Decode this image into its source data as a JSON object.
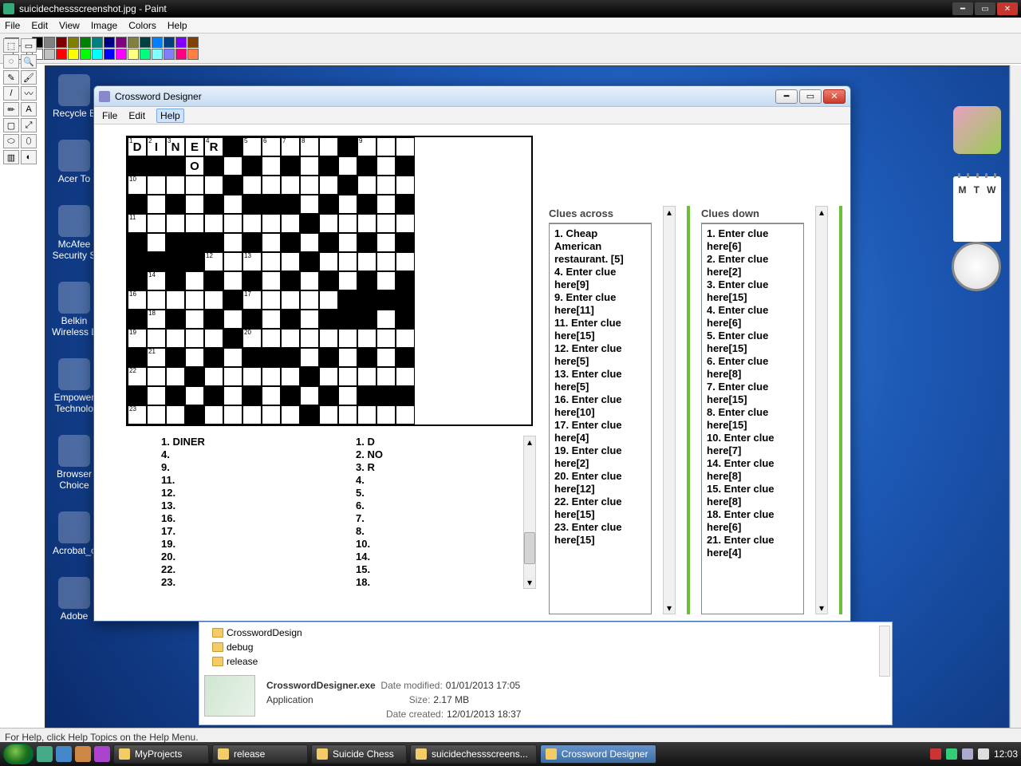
{
  "paint": {
    "title": "suicidechessscreenshot.jpg - Paint",
    "menu": [
      "File",
      "Edit",
      "View",
      "Image",
      "Colors",
      "Help"
    ],
    "palette": [
      "#000000",
      "#808080",
      "#800000",
      "#808000",
      "#008000",
      "#008080",
      "#000080",
      "#800080",
      "#808040",
      "#004040",
      "#0080ff",
      "#004080",
      "#8000ff",
      "#804000",
      "#ffffff",
      "#c0c0c0",
      "#ff0000",
      "#ffff00",
      "#00ff00",
      "#00ffff",
      "#0000ff",
      "#ff00ff",
      "#ffff80",
      "#00ff80",
      "#80ffff",
      "#8080ff",
      "#ff0080",
      "#ff8040"
    ],
    "status": "For Help, click Help Topics on the Help Menu."
  },
  "desktop_icons": [
    "Recycle B",
    "Acer To",
    "McAfee Security S",
    "Belkin Wireless L",
    "Empower Technolo",
    "Browser Choice",
    "Acrobat_c",
    "Adobe"
  ],
  "cd": {
    "title": "Crossword Designer",
    "menu": [
      "File",
      "Edit",
      "Help"
    ],
    "grid_size": 15,
    "black": [
      [
        0,
        5
      ],
      [
        0,
        11
      ],
      [
        1,
        0
      ],
      [
        1,
        1
      ],
      [
        1,
        2
      ],
      [
        1,
        4
      ],
      [
        1,
        6
      ],
      [
        1,
        8
      ],
      [
        1,
        10
      ],
      [
        1,
        12
      ],
      [
        1,
        14
      ],
      [
        2,
        5
      ],
      [
        2,
        11
      ],
      [
        3,
        0
      ],
      [
        3,
        2
      ],
      [
        3,
        4
      ],
      [
        3,
        6
      ],
      [
        3,
        7
      ],
      [
        3,
        8
      ],
      [
        3,
        10
      ],
      [
        3,
        12
      ],
      [
        3,
        14
      ],
      [
        4,
        9
      ],
      [
        5,
        0
      ],
      [
        5,
        2
      ],
      [
        5,
        3
      ],
      [
        5,
        4
      ],
      [
        5,
        6
      ],
      [
        5,
        8
      ],
      [
        5,
        10
      ],
      [
        5,
        12
      ],
      [
        5,
        14
      ],
      [
        6,
        0
      ],
      [
        6,
        1
      ],
      [
        6,
        2
      ],
      [
        6,
        3
      ],
      [
        6,
        9
      ],
      [
        7,
        0
      ],
      [
        7,
        2
      ],
      [
        7,
        4
      ],
      [
        7,
        6
      ],
      [
        7,
        8
      ],
      [
        7,
        10
      ],
      [
        7,
        12
      ],
      [
        7,
        14
      ],
      [
        8,
        5
      ],
      [
        8,
        11
      ],
      [
        8,
        12
      ],
      [
        8,
        13
      ],
      [
        8,
        14
      ],
      [
        9,
        0
      ],
      [
        9,
        2
      ],
      [
        9,
        4
      ],
      [
        9,
        6
      ],
      [
        9,
        8
      ],
      [
        9,
        10
      ],
      [
        9,
        11
      ],
      [
        9,
        12
      ],
      [
        9,
        14
      ],
      [
        10,
        5
      ],
      [
        11,
        0
      ],
      [
        11,
        2
      ],
      [
        11,
        4
      ],
      [
        11,
        6
      ],
      [
        11,
        7
      ],
      [
        11,
        8
      ],
      [
        11,
        10
      ],
      [
        11,
        12
      ],
      [
        11,
        14
      ],
      [
        12,
        3
      ],
      [
        12,
        9
      ],
      [
        13,
        0
      ],
      [
        13,
        2
      ],
      [
        13,
        4
      ],
      [
        13,
        6
      ],
      [
        13,
        8
      ],
      [
        13,
        10
      ],
      [
        13,
        12
      ],
      [
        13,
        13
      ],
      [
        13,
        14
      ],
      [
        14,
        3
      ],
      [
        14,
        9
      ]
    ],
    "numbers": {
      "0,0": "1",
      "0,1": "2",
      "0,2": "3",
      "0,4": "4",
      "0,6": "5",
      "0,7": "6",
      "0,8": "7",
      "0,9": "8",
      "0,12": "9",
      "2,0": "10",
      "4,0": "11",
      "6,4": "12",
      "6,6": "13",
      "7,1": "14",
      "8,0": "16",
      "8,6": "17",
      "9,1": "18",
      "10,0": "19",
      "10,6": "20",
      "11,1": "21",
      "12,0": "22",
      "14,0": "23"
    },
    "letters": {
      "0,0": "D",
      "0,1": "I",
      "0,2": "N",
      "0,3": "E",
      "0,4": "R",
      "1,3": "O"
    },
    "answers_across": [
      {
        "n": "1",
        "a": "DINER"
      },
      {
        "n": "4",
        "a": ""
      },
      {
        "n": "9",
        "a": ""
      },
      {
        "n": "11",
        "a": ""
      },
      {
        "n": "12",
        "a": ""
      },
      {
        "n": "13",
        "a": ""
      },
      {
        "n": "16",
        "a": ""
      },
      {
        "n": "17",
        "a": ""
      },
      {
        "n": "19",
        "a": ""
      },
      {
        "n": "20",
        "a": ""
      },
      {
        "n": "22",
        "a": ""
      },
      {
        "n": "23",
        "a": ""
      }
    ],
    "answers_down": [
      {
        "n": "1",
        "a": "D"
      },
      {
        "n": "2",
        "a": "NO"
      },
      {
        "n": "3",
        "a": "R"
      },
      {
        "n": "4",
        "a": ""
      },
      {
        "n": "5",
        "a": ""
      },
      {
        "n": "6",
        "a": ""
      },
      {
        "n": "7",
        "a": ""
      },
      {
        "n": "8",
        "a": ""
      },
      {
        "n": "10",
        "a": ""
      },
      {
        "n": "14",
        "a": ""
      },
      {
        "n": "15",
        "a": ""
      },
      {
        "n": "18",
        "a": ""
      }
    ],
    "clues_across_head": "Clues across",
    "clues_down_head": "Clues down",
    "clues_across": [
      "1. Cheap American restaurant. [5]",
      "4. Enter clue here[9]",
      "9. Enter clue here[11]",
      "11. Enter clue here[15]",
      "12. Enter clue here[5]",
      "13. Enter clue here[5]",
      "16. Enter clue here[10]",
      "17. Enter clue here[4]",
      "19. Enter clue here[2]",
      "20. Enter clue here[12]",
      "22. Enter clue here[15]",
      "23. Enter clue here[15]"
    ],
    "clues_down": [
      "1. Enter clue here[6]",
      "2. Enter clue here[2]",
      "3. Enter clue here[15]",
      "4. Enter clue here[6]",
      "5. Enter clue here[15]",
      "6. Enter clue here[8]",
      "7. Enter clue here[15]",
      "8. Enter clue here[15]",
      "10. Enter clue here[7]",
      "14. Enter clue here[8]",
      "15. Enter clue here[8]",
      "18. Enter clue here[6]",
      "21. Enter clue here[4]"
    ]
  },
  "explorer": {
    "folders": [
      "CrosswordDesign",
      "debug",
      "release"
    ],
    "file_name": "CrosswordDesigner.exe",
    "file_type": "Application",
    "date_modified_k": "Date modified:",
    "date_modified": "01/01/2013 17:05",
    "size_k": "Size:",
    "size": "2.17 MB",
    "date_created_k": "Date created:",
    "date_created": "12/01/2013 18:37"
  },
  "taskbar": {
    "items": [
      "MyProjects",
      "release",
      "Suicide Chess",
      "suicidechessscreens...",
      "Crossword Designer"
    ],
    "clock": "12:03"
  },
  "calendar_hint": [
    "M",
    "T",
    "W"
  ]
}
